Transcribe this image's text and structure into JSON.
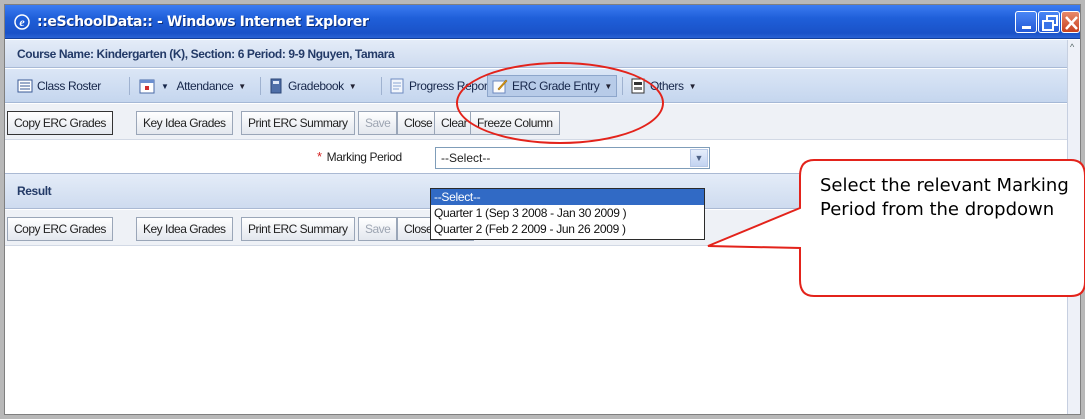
{
  "window": {
    "title": "::eSchoolData:: - Windows Internet Explorer"
  },
  "course": {
    "header": "Course Name: Kindergarten (K), Section: 6 Period: 9-9 Nguyen, Tamara"
  },
  "menu": {
    "items": [
      {
        "label": "Class Roster",
        "icon": "roster-icon",
        "dropdown": false
      },
      {
        "label": "Attendance",
        "icon": "calendar-icon",
        "dropdown": true
      },
      {
        "label": "Gradebook",
        "icon": "book-icon",
        "dropdown": true
      },
      {
        "label": "Progress Report",
        "icon": "report-icon",
        "dropdown": false
      },
      {
        "label": "ERC Grade Entry",
        "icon": "grade-entry-icon",
        "dropdown": true
      },
      {
        "label": "Others",
        "icon": "others-icon",
        "dropdown": true
      }
    ]
  },
  "toolbar": {
    "copy_erc": "Copy ERC Grades",
    "key_idea": "Key Idea Grades",
    "print_erc": "Print ERC Summary",
    "save": "Save",
    "close": "Close",
    "clear": "Clear",
    "freeze": "Freeze Column"
  },
  "marking_period": {
    "label": "Marking Period",
    "required_mark": "*",
    "selected": "--Select--",
    "options": [
      "--Select--",
      "Quarter 1 (Sep 3 2008 - Jan 30 2009 )",
      "Quarter 2 (Feb 2 2009 - Jun 26 2009 )"
    ]
  },
  "result": {
    "title": "Result"
  },
  "callout": {
    "text": "Select the relevant Marking Period from the dropdown"
  },
  "colors": {
    "annotation": "#e3231b",
    "titlebar": "#1f5fd9",
    "selection": "#316ac5"
  }
}
